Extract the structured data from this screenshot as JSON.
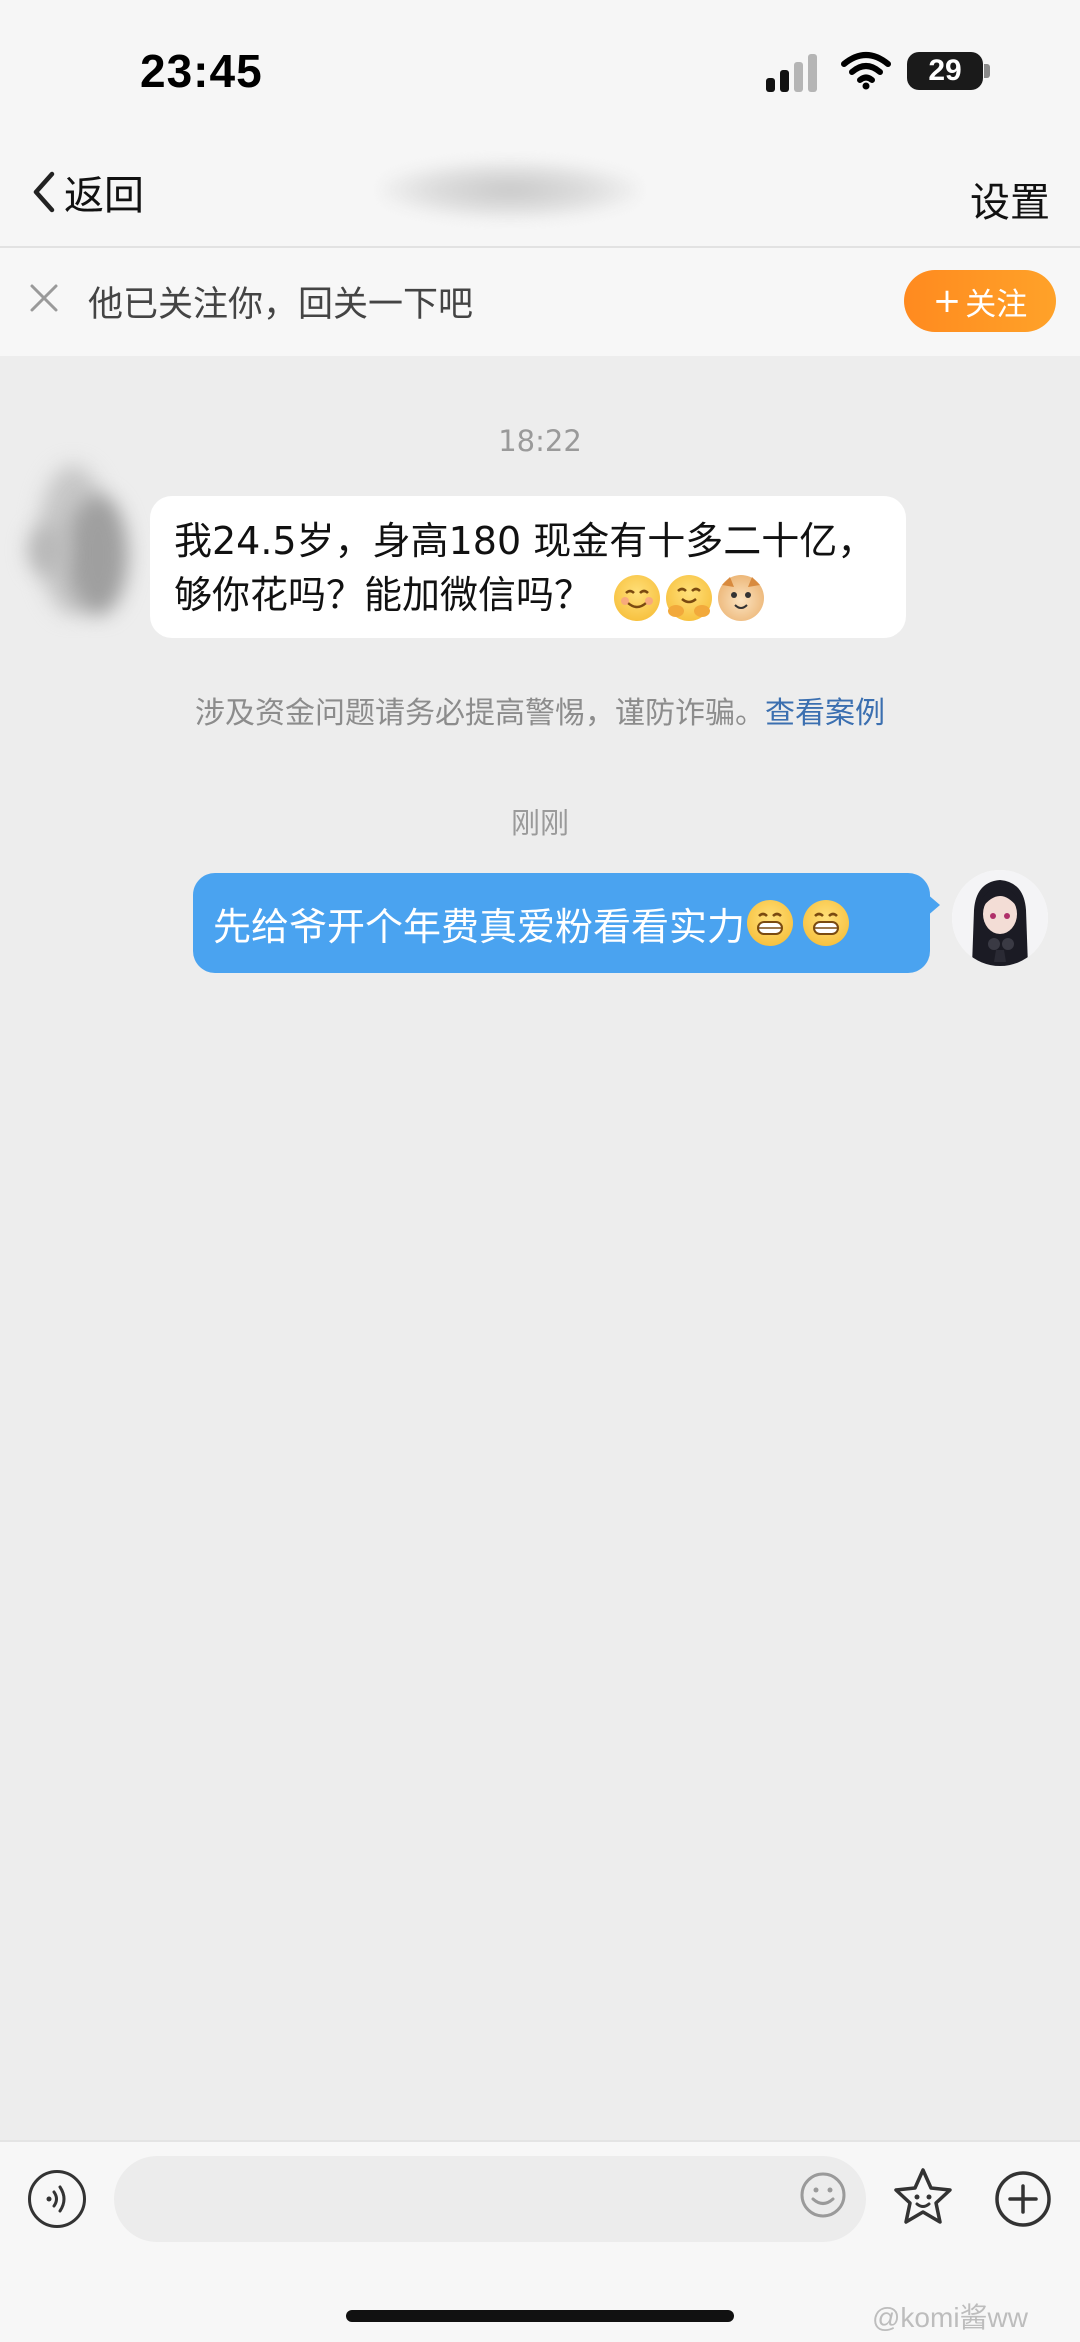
{
  "status_bar": {
    "time": "23:45",
    "battery": "29"
  },
  "nav": {
    "back_label": "返回",
    "settings_label": "设置"
  },
  "follow_banner": {
    "text": "他已关注你，回关一下吧",
    "button_plus": "+",
    "button_label": "关注",
    "accent": "#ff9a24"
  },
  "messages": {
    "time_1": "18:22",
    "incoming_text": "我24.5岁，身高180 现金有十多二十亿，够你花吗？能加微信吗？",
    "incoming_emojis": [
      "smiling-face-emoji",
      "hugging-face-emoji",
      "cat-face-emoji"
    ],
    "warning_text": "涉及资金问题请务必提高警惕，谨防诈骗。",
    "warning_link": "查看案例",
    "time_2": "刚刚",
    "outgoing_text": "先给爷开个年费真爱粉看看实力",
    "outgoing_emojis": [
      "grinning-face-emoji",
      "grinning-face-emoji"
    ],
    "outgoing_color": "#4aa3f0"
  },
  "input": {
    "placeholder": ""
  },
  "watermark": "@komi酱ww"
}
